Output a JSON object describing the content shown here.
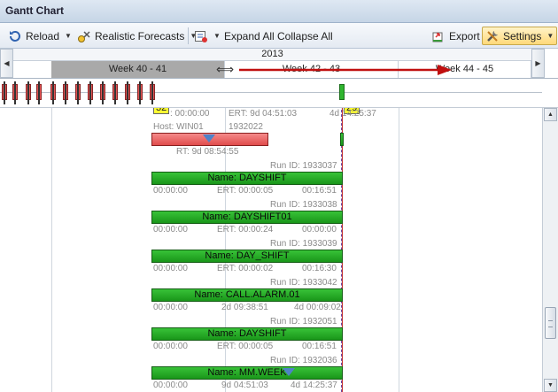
{
  "window": {
    "title": "Gantt Chart"
  },
  "toolbar": {
    "reload_label": "Reload",
    "forecasts_label": "Realistic Forecasts",
    "expand_label": "Expand All",
    "collapse_label": "Collapse All",
    "export_label": "Export",
    "settings_label": "Settings"
  },
  "timeline": {
    "year": "2013",
    "weeks": [
      "Week 40 - 41",
      "Week 42 - 43",
      "Week 44 - 45"
    ],
    "selected_week_index": 0
  },
  "badges": {
    "left": "32",
    "right": "29"
  },
  "jobs": {
    "top": {
      "time": ": 00:00:00",
      "ert": "ERT: 9d 04:51:03",
      "end": "4d 14:25:37"
    },
    "host": {
      "label": "Host: WIN01",
      "run_id": "1932022"
    },
    "rt": "RT: 9d 08:54:55",
    "items": [
      {
        "run_id": "Run ID: 1933037",
        "name": "Name: DAYSHIFT",
        "start": "00:00:00",
        "ert": "ERT: 00:00:05",
        "end": "00:16:51"
      },
      {
        "run_id": "Run ID: 1933038",
        "name": "Name: DAYSHIFT01",
        "start": "00:00:00",
        "ert": "ERT: 00:00:24",
        "end": "00:00:00"
      },
      {
        "run_id": "Run ID: 1933039",
        "name": "Name: DAY_SHIFT",
        "start": "00:00:00",
        "ert": "ERT: 00:00:02",
        "end": "00:16:30"
      },
      {
        "run_id": "Run ID: 1933042",
        "name": "Name: CALL.ALARM.01",
        "start": "00:00:00",
        "ert": "2d 09:38:51",
        "end": "4d 00:09:02"
      },
      {
        "run_id": "Run ID: 1932051",
        "name": "Name: DAYSHIFT",
        "start": "00:00:00",
        "ert": "ERT: 00:00:05",
        "end": "00:16:51"
      },
      {
        "run_id": "Run ID: 1932036",
        "name": "Name: MM.WEEK",
        "start": "00:00:00",
        "ert": "9d 04:51:03",
        "end": "4d 14:25:37"
      }
    ]
  },
  "colors": {
    "job_green": "#199619",
    "job_red": "#e04c4c",
    "selected_week": "#a9a9a9",
    "now_line": "#c03030"
  },
  "icons": {
    "reload": "reload-icon",
    "forecasts": "forecast-icon",
    "filter": "filter-icon",
    "export": "export-icon",
    "settings": "settings-icon"
  }
}
